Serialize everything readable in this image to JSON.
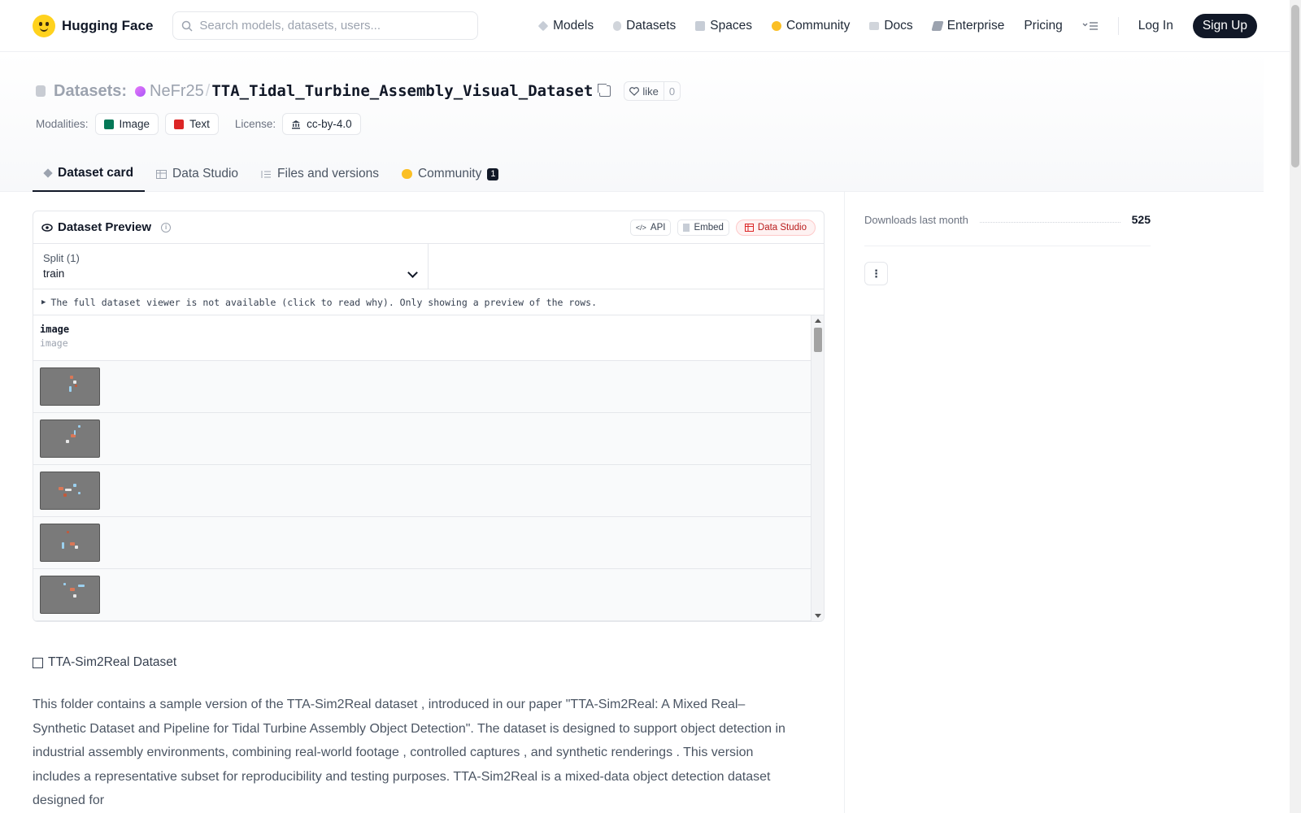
{
  "nav": {
    "brand": "Hugging Face",
    "search_placeholder": "Search models, datasets, users...",
    "links": [
      "Models",
      "Datasets",
      "Spaces",
      "Community",
      "Docs",
      "Enterprise",
      "Pricing"
    ],
    "login": "Log In",
    "signup": "Sign Up"
  },
  "header": {
    "crumb_label": "Datasets:",
    "org": "NeFr25",
    "repo": "TTA_Tidal_Turbine_Assembly_Visual_Dataset",
    "like_label": "like",
    "like_count": "0",
    "modalities_label": "Modalities:",
    "modalities": [
      "Image",
      "Text"
    ],
    "license_label": "License:",
    "license": "cc-by-4.0",
    "tabs": [
      {
        "label": "Dataset card",
        "active": true
      },
      {
        "label": "Data Studio"
      },
      {
        "label": "Files and versions"
      },
      {
        "label": "Community",
        "badge": "1"
      }
    ]
  },
  "preview": {
    "title": "Dataset Preview",
    "buttons": [
      "API",
      "Embed",
      "Data Studio"
    ],
    "split_label": "Split (1)",
    "split_value": "train",
    "notice": "The full dataset viewer is not available (click to read why). Only showing a preview of the rows.",
    "column": {
      "name": "image",
      "type": "image"
    },
    "row_count": 5
  },
  "readme": {
    "heading": "TTA-Sim2Real Dataset",
    "body": "This folder contains a sample version of the TTA-Sim2Real dataset , introduced in our paper \"TTA-Sim2Real: A Mixed Real–Synthetic Dataset and Pipeline for Tidal Turbine Assembly Object Detection\". The dataset is designed to support object detection in industrial assembly environments, combining real-world footage , controlled captures , and synthetic renderings . This version includes a representative subset for reproducibility and testing purposes. TTA-Sim2Real is a mixed-data object detection dataset designed for"
  },
  "sidebar": {
    "downloads_label": "Downloads last month",
    "downloads_value": "525"
  }
}
